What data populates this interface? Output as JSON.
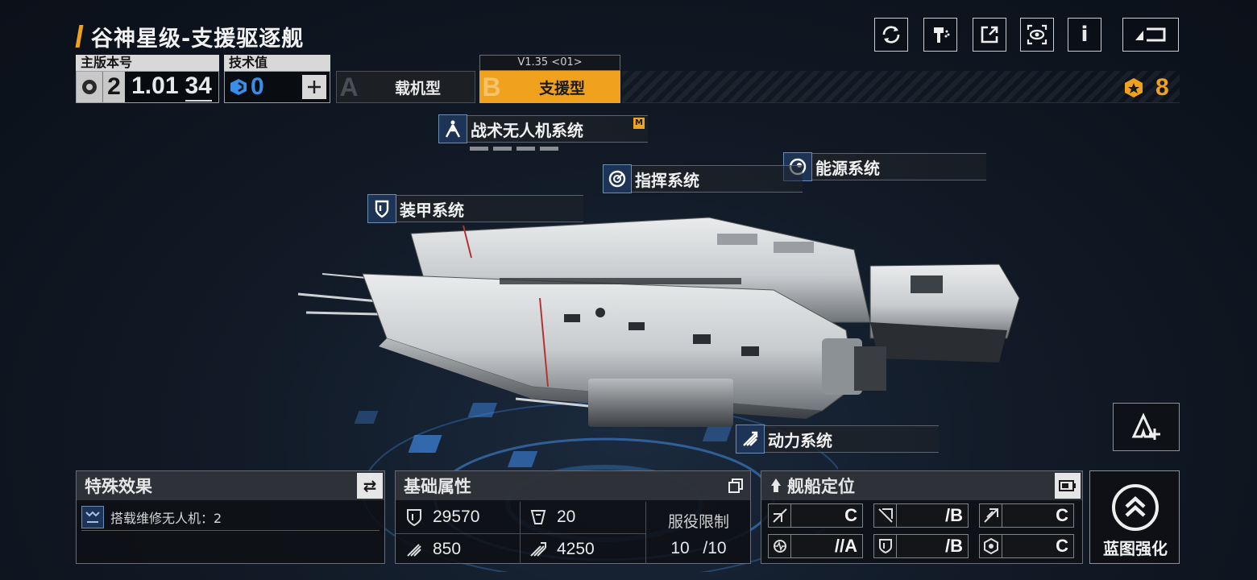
{
  "title": "谷神星级-支援驱逐舰",
  "top_icons": [
    "refresh-icon",
    "paint-icon",
    "share-icon",
    "view-icon",
    "info-icon",
    "back-icon"
  ],
  "version": {
    "label": "主版本号",
    "major": "2",
    "minor": "1.01",
    "sub": "34"
  },
  "tech": {
    "label": "技术值",
    "value": "0"
  },
  "tabs": [
    {
      "letter": "A",
      "label": "载机型"
    },
    {
      "letter": "B",
      "label": "支援型",
      "version": "V1.35 <01>"
    }
  ],
  "count": "8",
  "systems": {
    "tactical_drone": "战术无人机系统",
    "tactical_badge": "M",
    "energy": "能源系统",
    "command": "指挥系统",
    "armor": "装甲系统",
    "power": "动力系统"
  },
  "special": {
    "title": "特殊效果",
    "effect": "搭载维修无人机：2"
  },
  "basic": {
    "title": "基础属性",
    "hp": "29570",
    "armor": "20",
    "speed": "850",
    "warp": "4250",
    "service_label": "服役限制",
    "service_current": "10",
    "service_max": "/10"
  },
  "positioning": {
    "title": "舰船定位",
    "grades": [
      "C",
      "/B",
      "C",
      "//A",
      "/B",
      "C"
    ]
  },
  "upgrade": {
    "label": "蓝图强化"
  },
  "colors": {
    "accent": "#f0a11e",
    "tech_blue": "#3a8ee8",
    "system_blue": "#1d3456"
  }
}
